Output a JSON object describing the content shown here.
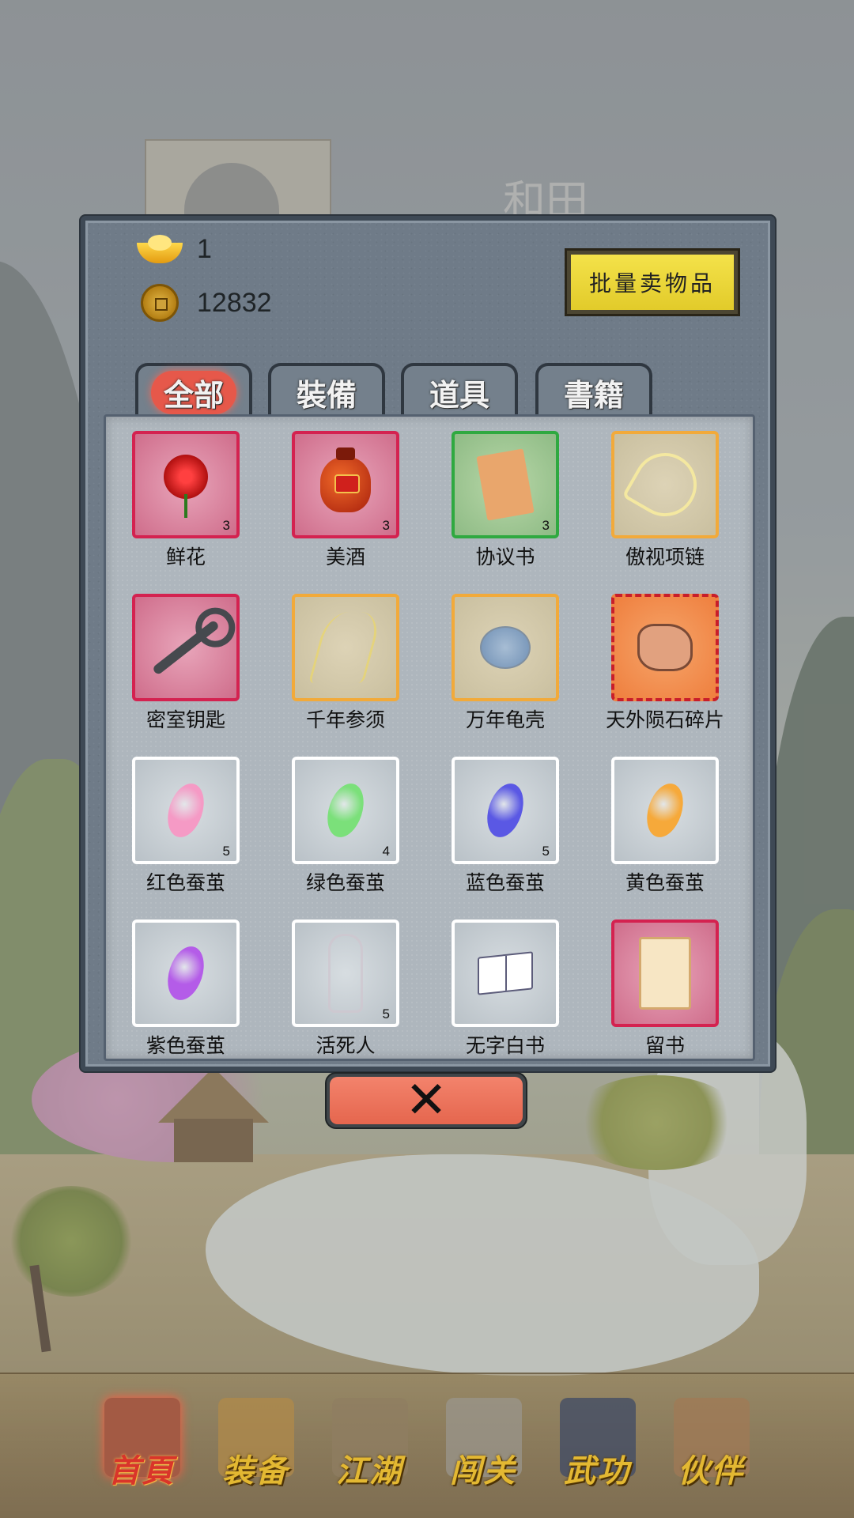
{
  "background": {
    "character_name": "和田"
  },
  "currency": {
    "ingot": "1",
    "coins": "12832"
  },
  "sell_button": "批量卖物品",
  "tabs": [
    {
      "label": "全部",
      "active": true
    },
    {
      "label": "裝備",
      "active": false
    },
    {
      "label": "道具",
      "active": false
    },
    {
      "label": "書籍",
      "active": false
    }
  ],
  "items": [
    {
      "name": "鲜花",
      "count": "3",
      "rarity": "red",
      "icon": "rose-icon"
    },
    {
      "name": "美酒",
      "count": "3",
      "rarity": "red",
      "icon": "wine-jar-icon"
    },
    {
      "name": "协议书",
      "count": "3",
      "rarity": "green",
      "icon": "document-icon"
    },
    {
      "name": "傲视项链",
      "count": "",
      "rarity": "orange",
      "icon": "necklace-icon"
    },
    {
      "name": "密室钥匙",
      "count": "",
      "rarity": "red",
      "icon": "key-icon"
    },
    {
      "name": "千年参须",
      "count": "",
      "rarity": "orange",
      "icon": "ginseng-icon"
    },
    {
      "name": "万年龟壳",
      "count": "",
      "rarity": "orange",
      "icon": "turtle-shell-icon"
    },
    {
      "name": "天外陨石碎片",
      "count": "",
      "rarity": "orange-fill",
      "icon": "meteorite-icon"
    },
    {
      "name": "红色蚕茧",
      "count": "5",
      "rarity": "white",
      "icon": "cocoon-icon",
      "color": "#f59ac5"
    },
    {
      "name": "绿色蚕茧",
      "count": "4",
      "rarity": "white",
      "icon": "cocoon-icon",
      "color": "#7be07a"
    },
    {
      "name": "蓝色蚕茧",
      "count": "5",
      "rarity": "white",
      "icon": "cocoon-icon",
      "color": "#5a58e4"
    },
    {
      "name": "黄色蚕茧",
      "count": "",
      "rarity": "white",
      "icon": "cocoon-icon",
      "color": "#f6a93a"
    },
    {
      "name": "紫色蚕茧",
      "count": "",
      "rarity": "white",
      "icon": "cocoon-icon",
      "color": "#b45ce8"
    },
    {
      "name": "活死人",
      "count": "5",
      "rarity": "white",
      "icon": "skeleton-icon"
    },
    {
      "name": "无字白书",
      "count": "",
      "rarity": "white",
      "icon": "book-icon"
    },
    {
      "name": "留书",
      "count": "",
      "rarity": "red",
      "icon": "letter-icon"
    }
  ],
  "close_glyph": "✕",
  "nav": [
    {
      "label": "首頁",
      "active": true,
      "icon": "house-icon",
      "color": "#a35a44"
    },
    {
      "label": "装备",
      "active": false,
      "icon": "armor-icon",
      "color": "#b08a4a"
    },
    {
      "label": "江湖",
      "active": false,
      "icon": "scroll-icon",
      "color": "#8f7d62"
    },
    {
      "label": "闯关",
      "active": false,
      "icon": "crossed-swords-icon",
      "color": "#9a968c"
    },
    {
      "label": "武功",
      "active": false,
      "icon": "manual-icon",
      "color": "#3e4a66"
    },
    {
      "label": "伙伴",
      "active": false,
      "icon": "partners-icon",
      "color": "#a07a56"
    }
  ]
}
